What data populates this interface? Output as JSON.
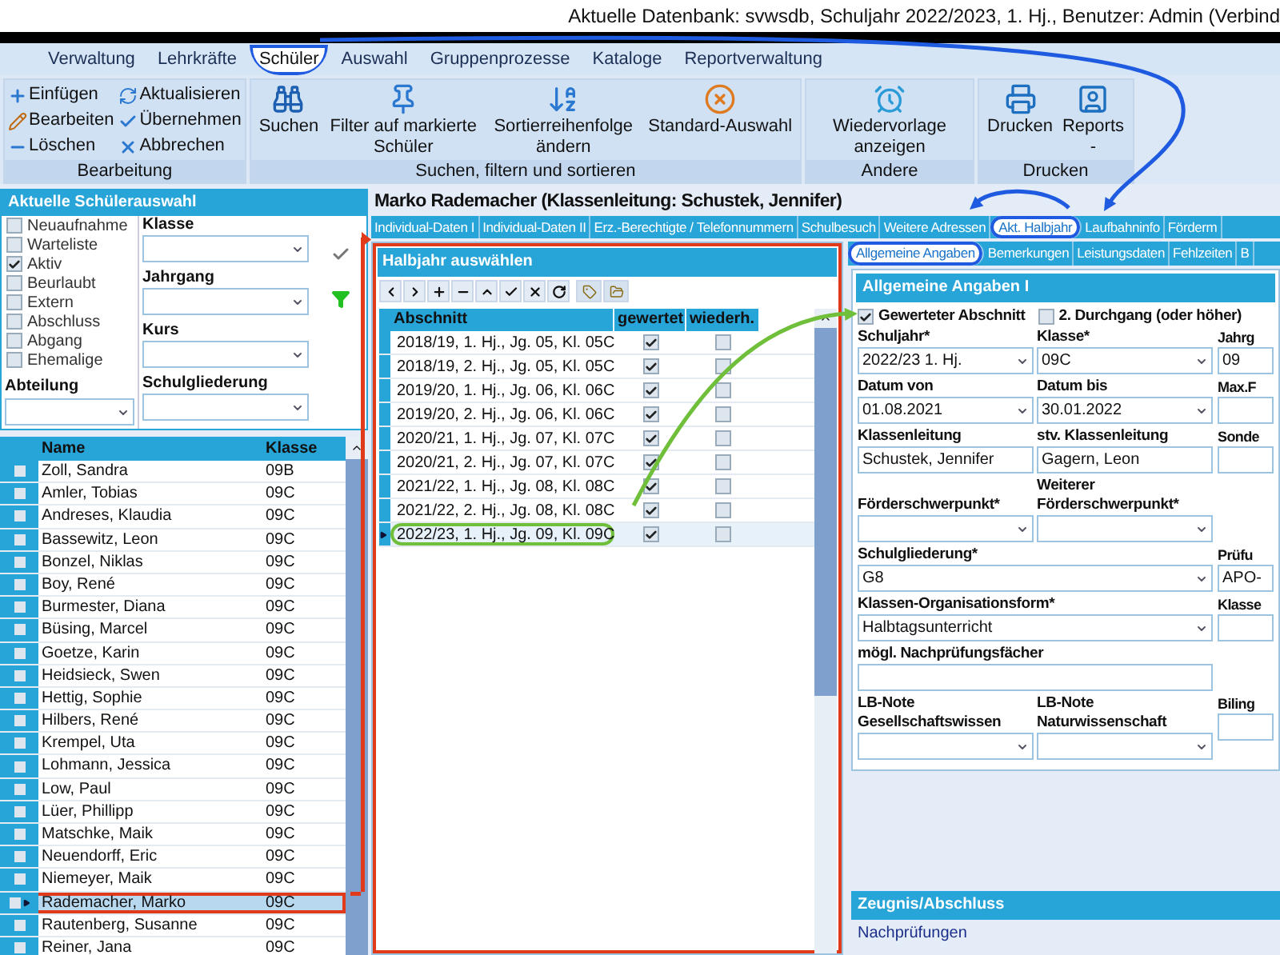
{
  "window": {
    "title": "Aktuelle Datenbank: svwsdb, Schuljahr 2022/2023, 1. Hj., Benutzer: Admin (Verbind"
  },
  "menu": [
    {
      "label": "Verwaltung",
      "selected": false,
      "circled": false
    },
    {
      "label": "Lehrkräfte",
      "selected": false,
      "circled": false
    },
    {
      "label": "Schüler",
      "selected": true,
      "circled": true
    },
    {
      "label": "Auswahl",
      "selected": false,
      "circled": false
    },
    {
      "label": "Gruppenprozesse",
      "selected": false,
      "circled": false
    },
    {
      "label": "Kataloge",
      "selected": false,
      "circled": false
    },
    {
      "label": "Reportverwaltung",
      "selected": false,
      "circled": false
    }
  ],
  "ribbon": {
    "groups": [
      {
        "label": "Bearbeitung",
        "kind": "small",
        "buttons": [
          {
            "label": "Einfügen"
          },
          {
            "label": "Bearbeiten"
          },
          {
            "label": "Löschen"
          },
          {
            "label": "Aktualisieren"
          },
          {
            "label": "Übernehmen"
          },
          {
            "label": "Abbrechen"
          }
        ]
      },
      {
        "label": "Suchen, filtern und sortieren",
        "kind": "large",
        "buttons": [
          {
            "label": "Suchen"
          },
          {
            "label": "Filter auf markierte Schüler"
          },
          {
            "label": "Sortierreihenfolge ändern"
          },
          {
            "label": "Standard-Auswahl"
          }
        ]
      },
      {
        "label": "Andere",
        "kind": "large",
        "buttons": [
          {
            "label": "Wiedervorlage anzeigen"
          }
        ]
      },
      {
        "label": "Drucken",
        "kind": "large",
        "buttons": [
          {
            "label": "Drucken"
          },
          {
            "label": "Reports",
            "sub": "-"
          }
        ]
      }
    ]
  },
  "selection": {
    "title": "Aktuelle Schülerauswahl",
    "statuses": [
      {
        "label": "Neuaufnahme",
        "checked": false
      },
      {
        "label": "Warteliste",
        "checked": false
      },
      {
        "label": "Aktiv",
        "checked": true
      },
      {
        "label": "Beurlaubt",
        "checked": false
      },
      {
        "label": "Extern",
        "checked": false
      },
      {
        "label": "Abschluss",
        "checked": false
      },
      {
        "label": "Abgang",
        "checked": false
      },
      {
        "label": "Ehemalige",
        "checked": false
      }
    ],
    "abteilung_label": "Abteilung",
    "filters": [
      {
        "label": "Klasse"
      },
      {
        "label": "Jahrgang"
      },
      {
        "label": "Kurs"
      },
      {
        "label": "Schulgliederung"
      }
    ]
  },
  "students": {
    "columns": [
      "Name",
      "Klasse"
    ],
    "rows": [
      {
        "name": "Zoll, Sandra",
        "klasse": "09B",
        "selected": false,
        "circled": false
      },
      {
        "name": "Amler, Tobias",
        "klasse": "09C",
        "selected": false,
        "circled": false
      },
      {
        "name": "Andreses, Klaudia",
        "klasse": "09C",
        "selected": false,
        "circled": false
      },
      {
        "name": "Bassewitz, Leon",
        "klasse": "09C",
        "selected": false,
        "circled": false
      },
      {
        "name": "Bonzel, Niklas",
        "klasse": "09C",
        "selected": false,
        "circled": false
      },
      {
        "name": "Boy, René",
        "klasse": "09C",
        "selected": false,
        "circled": false
      },
      {
        "name": "Burmester, Diana",
        "klasse": "09C",
        "selected": false,
        "circled": false
      },
      {
        "name": "Büsing, Marcel",
        "klasse": "09C",
        "selected": false,
        "circled": false
      },
      {
        "name": "Goetze, Karin",
        "klasse": "09C",
        "selected": false,
        "circled": false
      },
      {
        "name": "Heidsieck, Swen",
        "klasse": "09C",
        "selected": false,
        "circled": false
      },
      {
        "name": "Hettig, Sophie",
        "klasse": "09C",
        "selected": false,
        "circled": false
      },
      {
        "name": "Hilbers, René",
        "klasse": "09C",
        "selected": false,
        "circled": false
      },
      {
        "name": "Krempel, Uta",
        "klasse": "09C",
        "selected": false,
        "circled": false
      },
      {
        "name": "Lohmann, Jessica",
        "klasse": "09C",
        "selected": false,
        "circled": false
      },
      {
        "name": "Low, Paul",
        "klasse": "09C",
        "selected": false,
        "circled": false
      },
      {
        "name": "Lüer, Phillipp",
        "klasse": "09C",
        "selected": false,
        "circled": false
      },
      {
        "name": "Matschke, Maik",
        "klasse": "09C",
        "selected": false,
        "circled": false
      },
      {
        "name": "Neuendorff, Eric",
        "klasse": "09C",
        "selected": false,
        "circled": false
      },
      {
        "name": "Niemeyer, Maik",
        "klasse": "09C",
        "selected": false,
        "circled": false
      },
      {
        "name": "Rademacher, Marko",
        "klasse": "09C",
        "selected": true,
        "circled": true
      },
      {
        "name": "Rautenberg, Susanne",
        "klasse": "09C",
        "selected": false,
        "circled": false
      },
      {
        "name": "Reiner, Jana",
        "klasse": "09C",
        "selected": false,
        "circled": false
      }
    ]
  },
  "student_title": "Marko Rademacher (Klassenleitung: Schustek, Jennifer)",
  "tabs": [
    {
      "label": "Individual-Daten I",
      "selected": false,
      "circled": false
    },
    {
      "label": "Individual-Daten II",
      "selected": false,
      "circled": false
    },
    {
      "label": "Erz.-Berechtigte / Telefonnummern",
      "selected": false,
      "circled": false
    },
    {
      "label": "Schulbesuch",
      "selected": false,
      "circled": false
    },
    {
      "label": "Weitere Adressen",
      "selected": false,
      "circled": false
    },
    {
      "label": "Akt. Halbjahr",
      "selected": true,
      "circled": true
    },
    {
      "label": "Laufbahninfo",
      "selected": false,
      "circled": false
    },
    {
      "label": "Förderm",
      "selected": false,
      "circled": false
    }
  ],
  "halbjahr": {
    "title": "Halbjahr auswählen",
    "framed": true,
    "columns": [
      "Abschnitt",
      "gewertet",
      "wiederh."
    ],
    "rows": [
      {
        "abschnitt": "2018/19, 1. Hj., Jg. 05, Kl. 05C",
        "gewertet": true,
        "wiederholt": false,
        "selected": false,
        "circled": false
      },
      {
        "abschnitt": "2018/19, 2. Hj., Jg. 05, Kl. 05C",
        "gewertet": true,
        "wiederholt": false,
        "selected": false,
        "circled": false
      },
      {
        "abschnitt": "2019/20, 1. Hj., Jg. 06, Kl. 06C",
        "gewertet": true,
        "wiederholt": false,
        "selected": false,
        "circled": false
      },
      {
        "abschnitt": "2019/20, 2. Hj., Jg. 06, Kl. 06C",
        "gewertet": true,
        "wiederholt": false,
        "selected": false,
        "circled": false
      },
      {
        "abschnitt": "2020/21, 1. Hj., Jg. 07, Kl. 07C",
        "gewertet": true,
        "wiederholt": false,
        "selected": false,
        "circled": false
      },
      {
        "abschnitt": "2020/21, 2. Hj., Jg. 07, Kl. 07C",
        "gewertet": true,
        "wiederholt": false,
        "selected": false,
        "circled": false
      },
      {
        "abschnitt": "2021/22, 1. Hj., Jg. 08, Kl. 08C",
        "gewertet": true,
        "wiederholt": false,
        "selected": false,
        "circled": false
      },
      {
        "abschnitt": "2021/22, 2. Hj., Jg. 08, Kl. 08C",
        "gewertet": true,
        "wiederholt": false,
        "selected": false,
        "circled": false
      },
      {
        "abschnitt": "2022/23, 1. Hj., Jg. 09, Kl. 09C",
        "gewertet": true,
        "wiederholt": false,
        "selected": true,
        "circled": true
      }
    ]
  },
  "subtabs": [
    {
      "label": "Allgemeine Angaben",
      "selected": true,
      "circled": true
    },
    {
      "label": "Bemerkungen",
      "selected": false,
      "circled": false
    },
    {
      "label": "Leistungsdaten",
      "selected": false,
      "circled": false
    },
    {
      "label": "Fehlzeiten",
      "selected": false,
      "circled": false
    },
    {
      "label": "B",
      "selected": false,
      "circled": false
    }
  ],
  "general": {
    "title": "Allgemeine Angaben I",
    "checkboxes": [
      {
        "label": "Gewerteter Abschnitt",
        "checked": true
      },
      {
        "label": "2. Durchgang (oder höher)",
        "checked": false
      }
    ],
    "rows": [
      {
        "main": [
          {
            "label": "Schuljahr*",
            "value": "2022/23 1. Hj.",
            "kind": "dropdown"
          },
          {
            "label": "Klasse*",
            "value": "09C",
            "kind": "dropdown"
          }
        ],
        "side": {
          "label": "Jahrg",
          "value": "09",
          "kind": "text"
        }
      },
      {
        "main": [
          {
            "label": "Datum von",
            "value": "01.08.2021",
            "kind": "dropdown"
          },
          {
            "label": "Datum bis",
            "value": "30.01.2022",
            "kind": "dropdown"
          }
        ],
        "side": {
          "label": "Max.F",
          "kind": "text"
        }
      },
      {
        "main": [
          {
            "label": "Klassenleitung",
            "value": "Schustek, Jennifer",
            "kind": "text"
          },
          {
            "label": "stv. Klassenleitung",
            "value": "Gagern, Leon",
            "kind": "text"
          }
        ],
        "side": {
          "label": "Sonde",
          "kind": "text"
        }
      },
      {
        "main": [
          {
            "label": "Förderschwerpunkt*",
            "kind": "dropdown"
          },
          {
            "label": "Weiterer Förderschwerpunkt*",
            "kind": "dropdown"
          }
        ]
      },
      {
        "main": [
          {
            "label": "Schulgliederung*",
            "value": "G8",
            "kind": "dropdown"
          }
        ],
        "side": {
          "label": "Prüfu",
          "value": "APO-",
          "kind": "text"
        }
      },
      {
        "main": [
          {
            "label": "Klassen-Organisationsform*",
            "value": "Halbtagsunterricht",
            "kind": "dropdown"
          }
        ],
        "side": {
          "label": "Klasse",
          "kind": "text"
        }
      },
      {
        "main": [
          {
            "label": "mögl. Nachprüfungsfächer",
            "kind": "text"
          }
        ]
      },
      {
        "main": [
          {
            "label": "LB-Note Gesellschaftswissen",
            "kind": "dropdown"
          },
          {
            "label": "LB-Note Naturwissenschaft",
            "kind": "dropdown"
          }
        ],
        "side": {
          "label": "Biling",
          "kind": "text"
        }
      }
    ]
  },
  "zeugnis": {
    "title": "Zeugnis/Abschluss",
    "link": "Nachprüfungen"
  }
}
